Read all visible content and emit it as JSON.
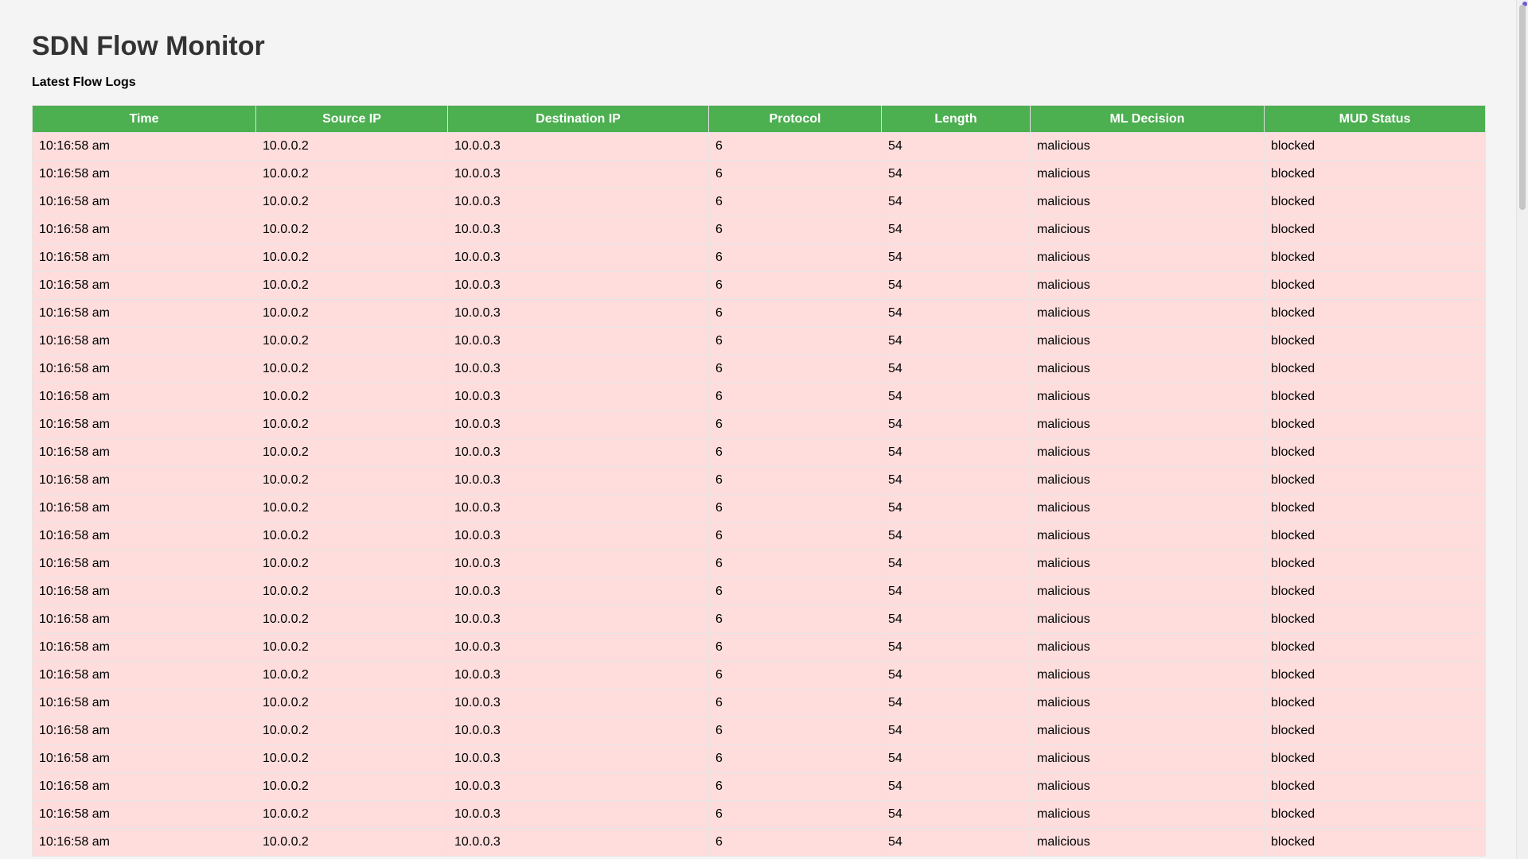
{
  "page": {
    "title": "SDN Flow Monitor",
    "subtitle": "Latest Flow Logs"
  },
  "table": {
    "columns": [
      "Time",
      "Source IP",
      "Destination IP",
      "Protocol",
      "Length",
      "ML Decision",
      "MUD Status"
    ],
    "rows": [
      [
        "10:16:58 am",
        "10.0.0.2",
        "10.0.0.3",
        "6",
        "54",
        "malicious",
        "blocked"
      ],
      [
        "10:16:58 am",
        "10.0.0.2",
        "10.0.0.3",
        "6",
        "54",
        "malicious",
        "blocked"
      ],
      [
        "10:16:58 am",
        "10.0.0.2",
        "10.0.0.3",
        "6",
        "54",
        "malicious",
        "blocked"
      ],
      [
        "10:16:58 am",
        "10.0.0.2",
        "10.0.0.3",
        "6",
        "54",
        "malicious",
        "blocked"
      ],
      [
        "10:16:58 am",
        "10.0.0.2",
        "10.0.0.3",
        "6",
        "54",
        "malicious",
        "blocked"
      ],
      [
        "10:16:58 am",
        "10.0.0.2",
        "10.0.0.3",
        "6",
        "54",
        "malicious",
        "blocked"
      ],
      [
        "10:16:58 am",
        "10.0.0.2",
        "10.0.0.3",
        "6",
        "54",
        "malicious",
        "blocked"
      ],
      [
        "10:16:58 am",
        "10.0.0.2",
        "10.0.0.3",
        "6",
        "54",
        "malicious",
        "blocked"
      ],
      [
        "10:16:58 am",
        "10.0.0.2",
        "10.0.0.3",
        "6",
        "54",
        "malicious",
        "blocked"
      ],
      [
        "10:16:58 am",
        "10.0.0.2",
        "10.0.0.3",
        "6",
        "54",
        "malicious",
        "blocked"
      ],
      [
        "10:16:58 am",
        "10.0.0.2",
        "10.0.0.3",
        "6",
        "54",
        "malicious",
        "blocked"
      ],
      [
        "10:16:58 am",
        "10.0.0.2",
        "10.0.0.3",
        "6",
        "54",
        "malicious",
        "blocked"
      ],
      [
        "10:16:58 am",
        "10.0.0.2",
        "10.0.0.3",
        "6",
        "54",
        "malicious",
        "blocked"
      ],
      [
        "10:16:58 am",
        "10.0.0.2",
        "10.0.0.3",
        "6",
        "54",
        "malicious",
        "blocked"
      ],
      [
        "10:16:58 am",
        "10.0.0.2",
        "10.0.0.3",
        "6",
        "54",
        "malicious",
        "blocked"
      ],
      [
        "10:16:58 am",
        "10.0.0.2",
        "10.0.0.3",
        "6",
        "54",
        "malicious",
        "blocked"
      ],
      [
        "10:16:58 am",
        "10.0.0.2",
        "10.0.0.3",
        "6",
        "54",
        "malicious",
        "blocked"
      ],
      [
        "10:16:58 am",
        "10.0.0.2",
        "10.0.0.3",
        "6",
        "54",
        "malicious",
        "blocked"
      ],
      [
        "10:16:58 am",
        "10.0.0.2",
        "10.0.0.3",
        "6",
        "54",
        "malicious",
        "blocked"
      ],
      [
        "10:16:58 am",
        "10.0.0.2",
        "10.0.0.3",
        "6",
        "54",
        "malicious",
        "blocked"
      ],
      [
        "10:16:58 am",
        "10.0.0.2",
        "10.0.0.3",
        "6",
        "54",
        "malicious",
        "blocked"
      ],
      [
        "10:16:58 am",
        "10.0.0.2",
        "10.0.0.3",
        "6",
        "54",
        "malicious",
        "blocked"
      ],
      [
        "10:16:58 am",
        "10.0.0.2",
        "10.0.0.3",
        "6",
        "54",
        "malicious",
        "blocked"
      ],
      [
        "10:16:58 am",
        "10.0.0.2",
        "10.0.0.3",
        "6",
        "54",
        "malicious",
        "blocked"
      ],
      [
        "10:16:58 am",
        "10.0.0.2",
        "10.0.0.3",
        "6",
        "54",
        "malicious",
        "blocked"
      ],
      [
        "10:16:58 am",
        "10.0.0.2",
        "10.0.0.3",
        "6",
        "54",
        "malicious",
        "blocked"
      ]
    ]
  },
  "colors": {
    "header_bg": "#4caf50",
    "row_bg_malicious": "#ffdddd",
    "page_bg": "#f4f4f4",
    "title_color": "#333333"
  }
}
